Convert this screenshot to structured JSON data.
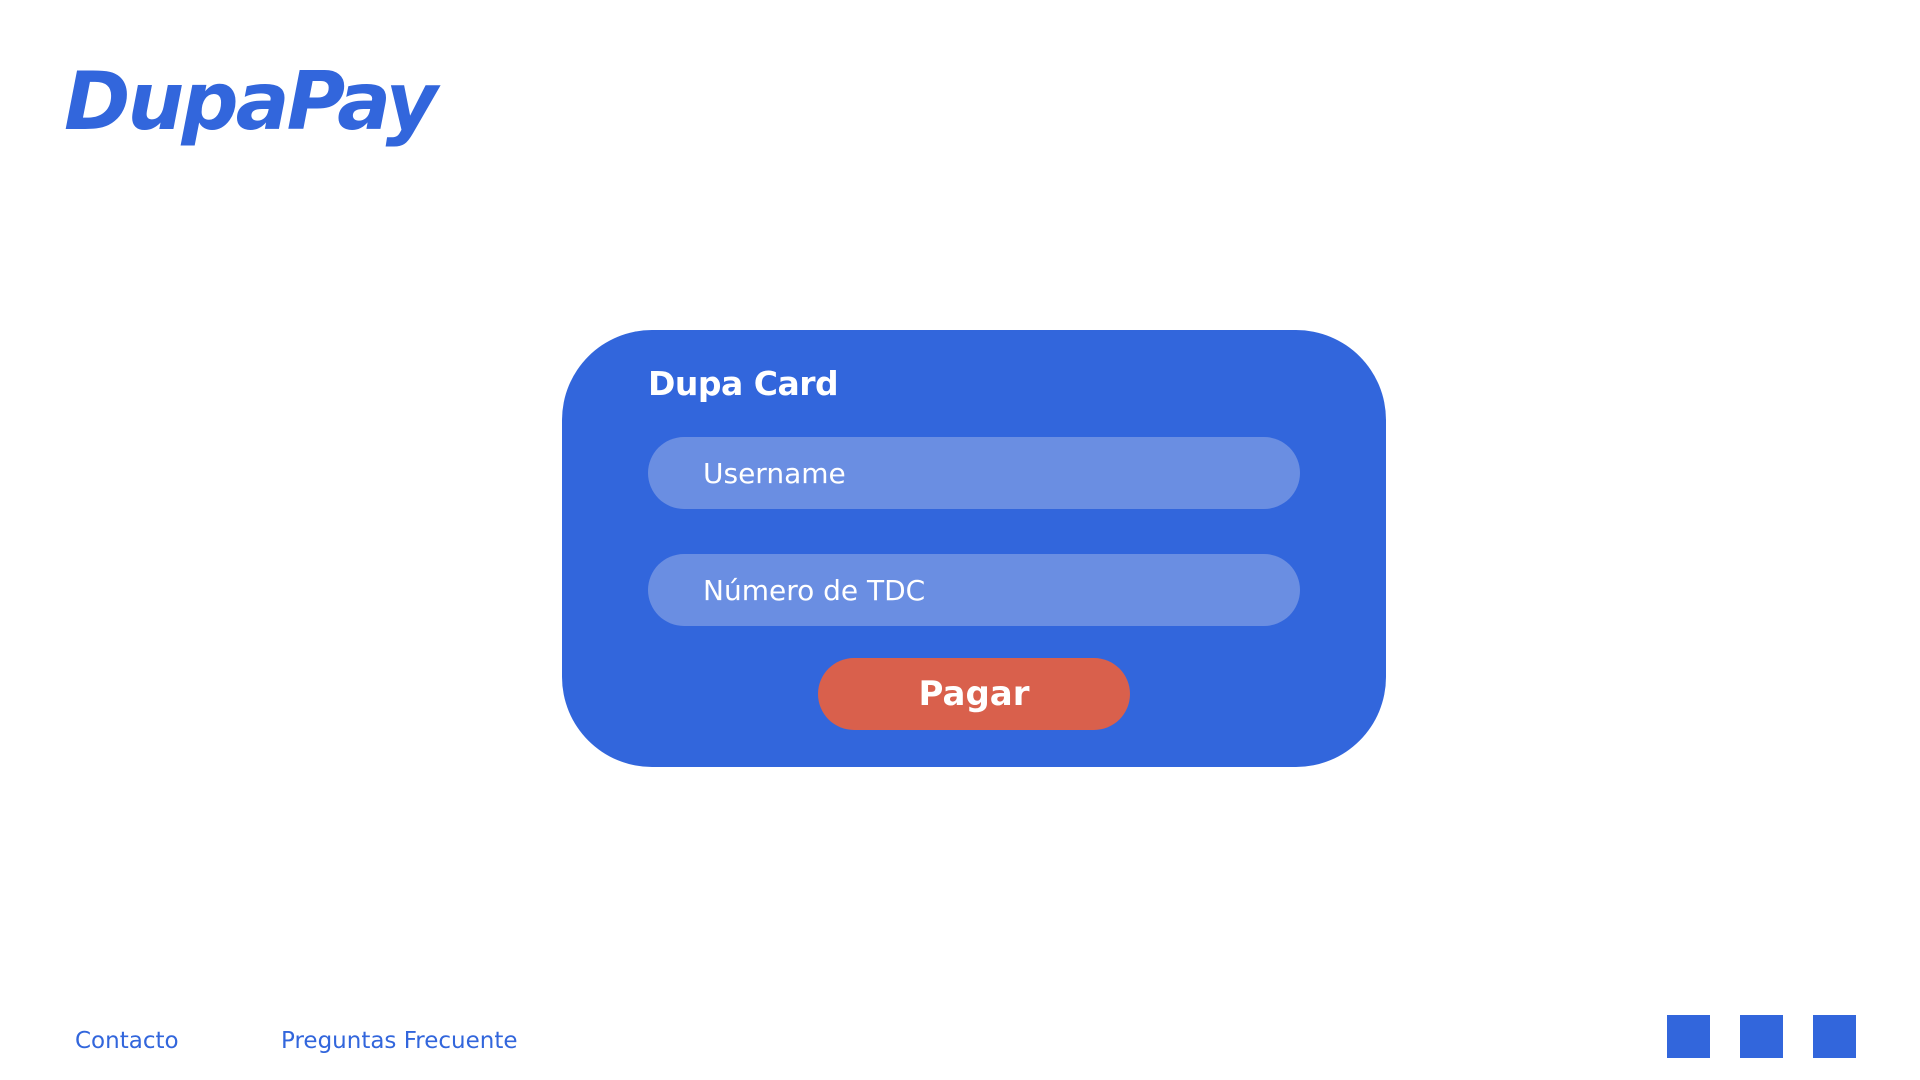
{
  "header": {
    "logo": "DupaPay"
  },
  "card": {
    "title": "Dupa Card",
    "username_placeholder": "Username",
    "tdc_placeholder": "Número de TDC",
    "pay_label": "Pagar"
  },
  "footer": {
    "links": [
      {
        "label": "Contacto"
      },
      {
        "label": "Preguntas Frecuente"
      }
    ],
    "social_icons": [
      "social-icon-1",
      "social-icon-2",
      "social-icon-3"
    ]
  },
  "colors": {
    "brand": "#3266dc",
    "input_fill": "#6a8ee2",
    "pay_button": "#d9604c",
    "background": "#ffffff"
  }
}
